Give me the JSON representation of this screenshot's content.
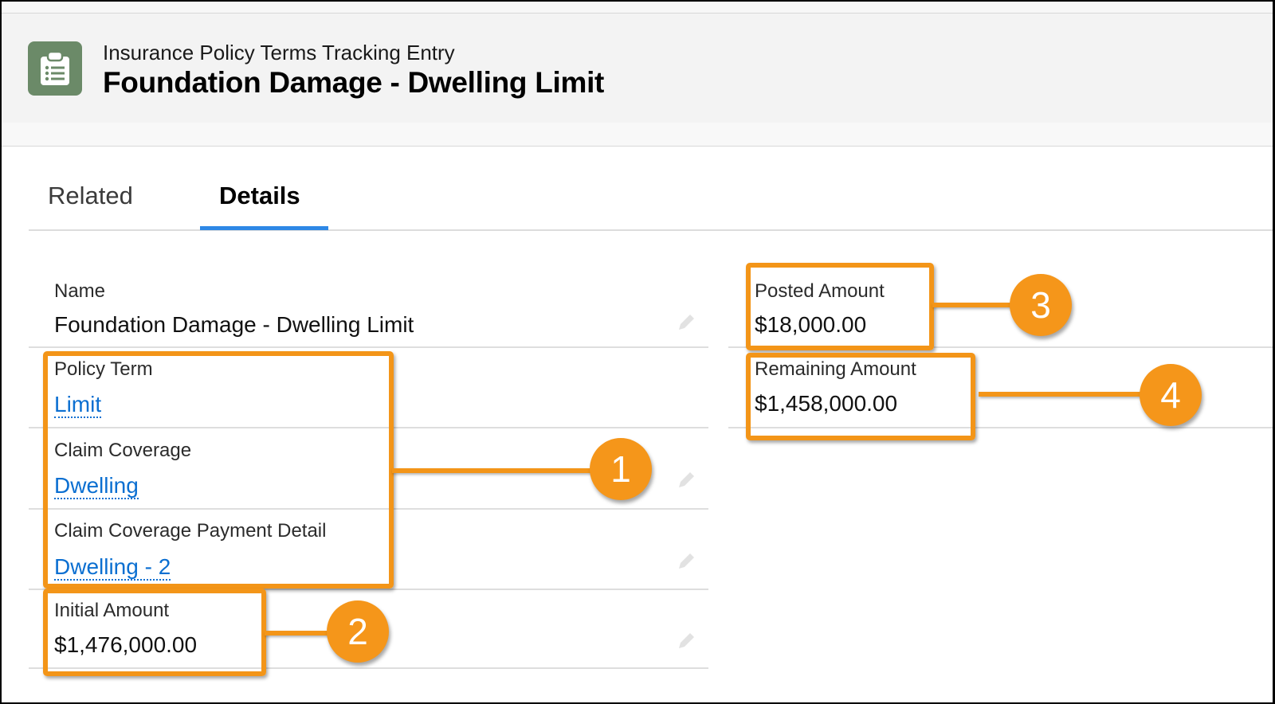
{
  "header": {
    "object_type": "Insurance Policy Terms Tracking Entry",
    "record_title": "Foundation Damage - Dwelling Limit",
    "icon": "clipboard-list-icon",
    "icon_color": "#6b8a68"
  },
  "tabs": [
    {
      "label": "Related",
      "active": false
    },
    {
      "label": "Details",
      "active": true
    }
  ],
  "tab_accent": "#2e88e6",
  "fields": {
    "name": {
      "label": "Name",
      "value": "Foundation Damage - Dwelling Limit"
    },
    "policy_term": {
      "label": "Policy Term",
      "value": "Limit"
    },
    "claim_coverage": {
      "label": "Claim Coverage",
      "value": "Dwelling"
    },
    "claim_coverage_payment_detail": {
      "label": "Claim Coverage Payment Detail",
      "value": "Dwelling - 2"
    },
    "initial_amount": {
      "label": "Initial Amount",
      "value": "$1,476,000.00"
    },
    "posted_amount": {
      "label": "Posted Amount",
      "value": "$18,000.00"
    },
    "remaining_amount": {
      "label": "Remaining Amount",
      "value": "$1,458,000.00"
    }
  },
  "annotations": [
    {
      "number": "1"
    },
    {
      "number": "2"
    },
    {
      "number": "3"
    },
    {
      "number": "4"
    }
  ],
  "annotation_color": "#f39518",
  "link_color": "#0b6fd1"
}
